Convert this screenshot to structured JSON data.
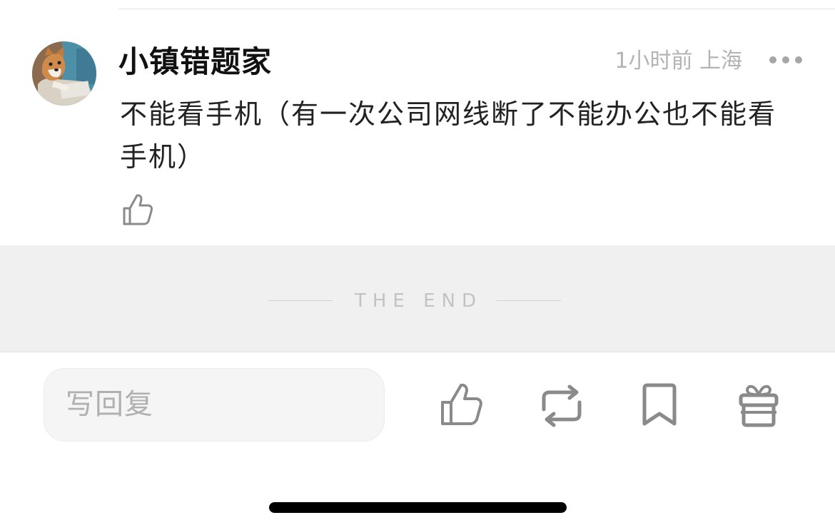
{
  "comment": {
    "username": "小镇错题家",
    "time_location": "1小时前 上海",
    "text": "不能看手机（有一次公司网线断了不能办公也不能看手机）",
    "avatar_icon": "shiba-dog-avatar",
    "like_icon": "thumbs-up-icon",
    "more_icon": "more-dots-icon"
  },
  "end_marker": "THE END",
  "toolbar": {
    "reply_placeholder": "写回复",
    "icons": [
      "thumbs-up-icon",
      "repost-icon",
      "bookmark-icon",
      "gift-icon"
    ]
  },
  "colors": {
    "meta_gray": "#b3b3b3",
    "band_bg": "#f0f0f0",
    "icon_gray": "#8a8a8a"
  }
}
